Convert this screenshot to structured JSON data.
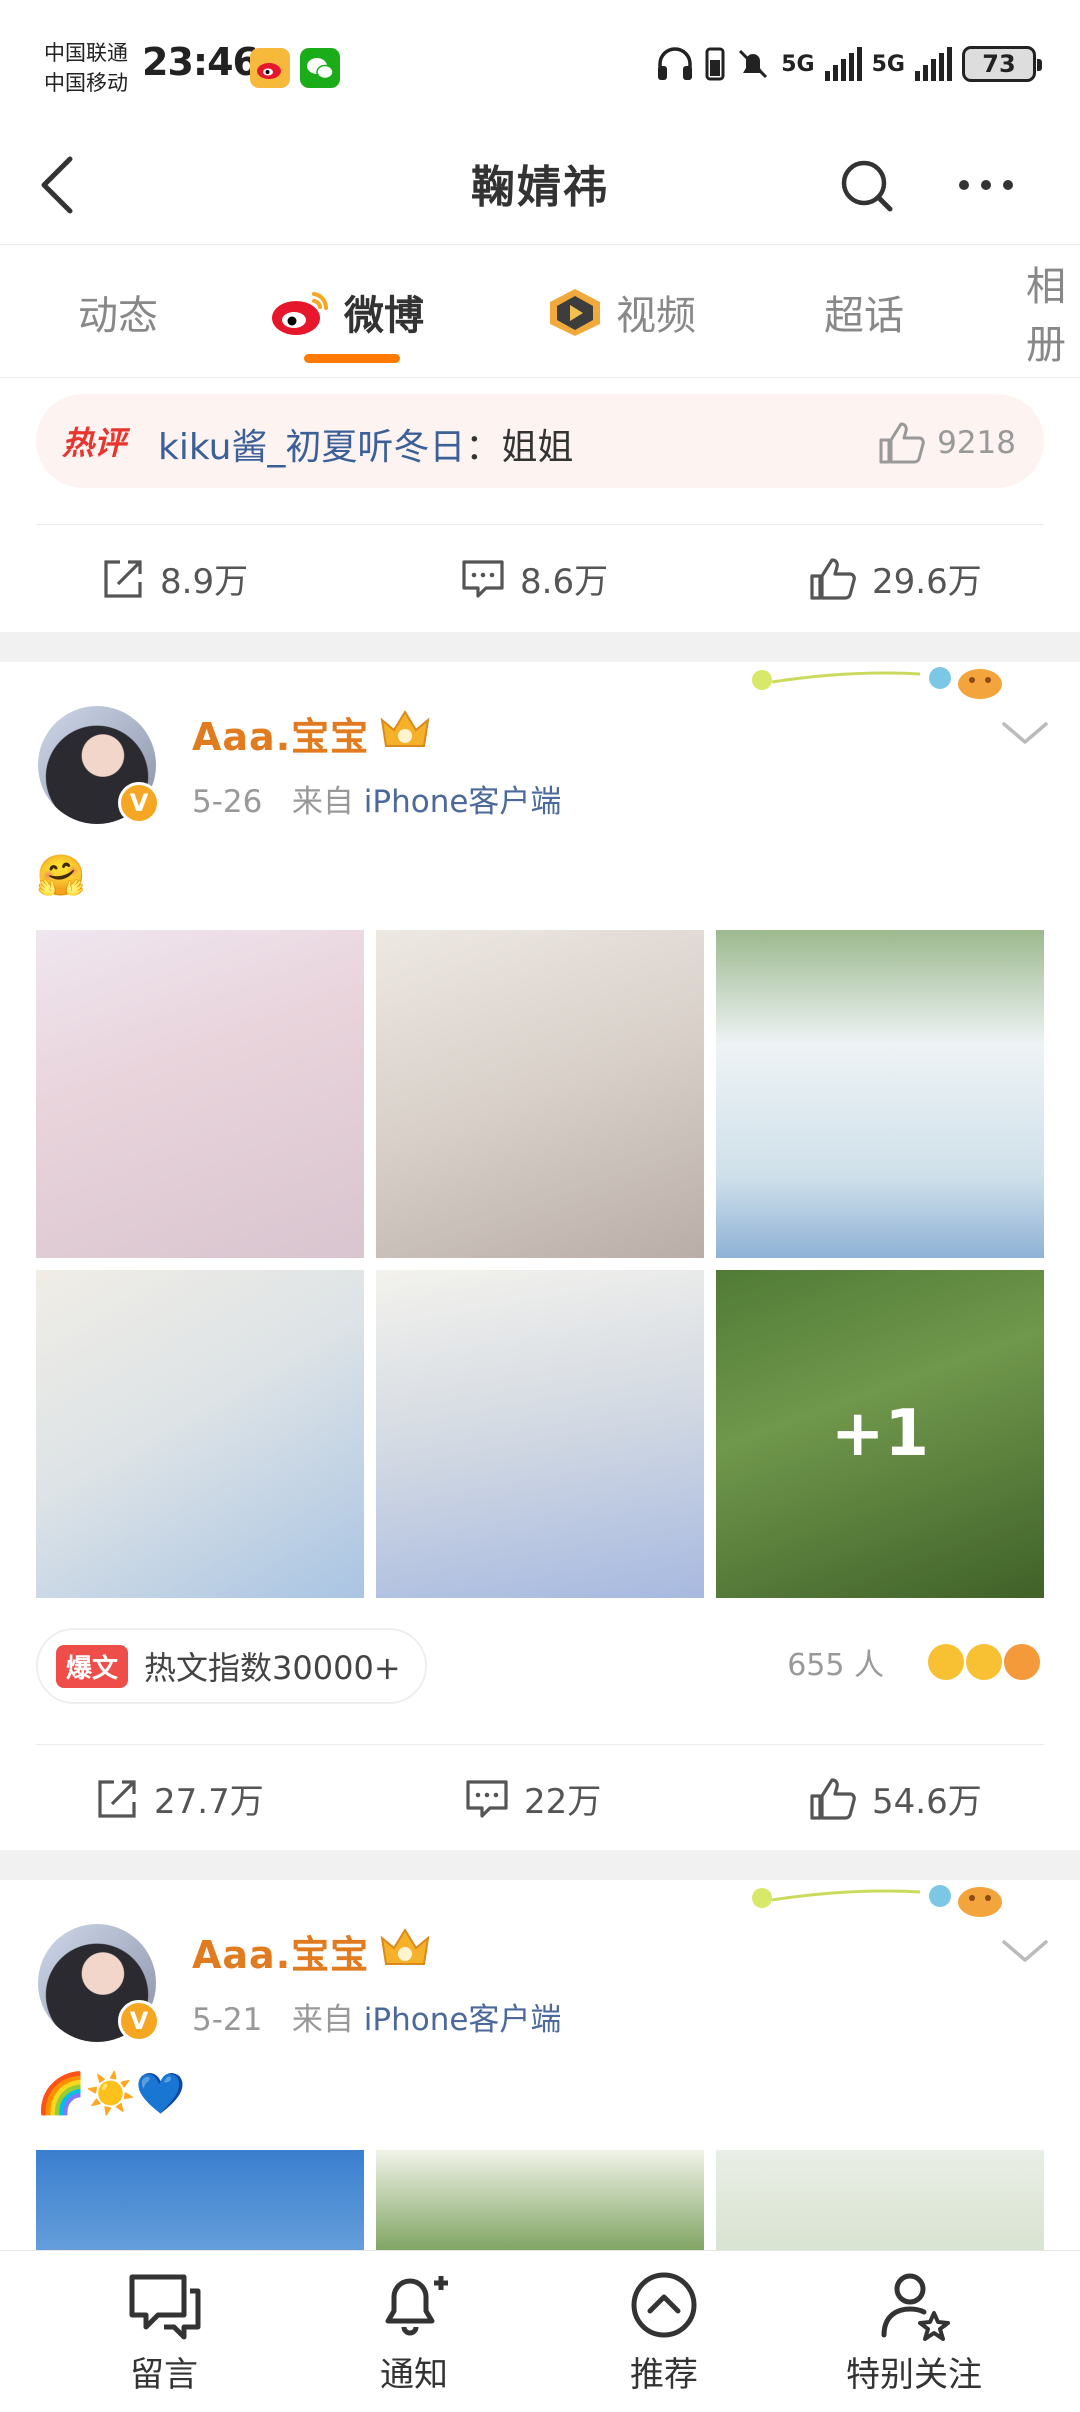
{
  "status_bar": {
    "carrier1": "中国联通",
    "carrier2": "中国移动",
    "time": "23:46",
    "net1": "5G",
    "net2": "5G",
    "battery": "73"
  },
  "header": {
    "title": "鞠婧祎"
  },
  "tabs": [
    {
      "label": "动态"
    },
    {
      "label": "微博"
    },
    {
      "label": "视频"
    },
    {
      "label": "超话"
    },
    {
      "label": "相册"
    }
  ],
  "hot_comment": {
    "badge": "热评",
    "user": "kiku酱_初夏听冬日",
    "text": "：姐姐",
    "likes": "9218"
  },
  "post0_actions": {
    "repost": "8.9万",
    "comment": "8.6万",
    "like": "29.6万"
  },
  "post1": {
    "username": "Aaa.宝宝",
    "date": "5-26",
    "source_prefix": "来自",
    "source": "iPhone客户端",
    "text": "🤗",
    "more_images": "+1",
    "hot_badge": "爆文",
    "hot_index": "热文指数30000+",
    "reactions": "655 人",
    "repost": "27.7万",
    "comment": "22万",
    "like": "54.6万",
    "verified": "V"
  },
  "post2": {
    "username": "Aaa.宝宝",
    "date": "5-21",
    "source_prefix": "来自",
    "source": "iPhone客户端",
    "text": "🌈☀️💙",
    "verified": "V"
  },
  "bottom_nav": [
    {
      "label": "留言",
      "icon": "message-icon"
    },
    {
      "label": "通知",
      "icon": "bell-plus-icon"
    },
    {
      "label": "推荐",
      "icon": "chevron-up-circle-icon"
    },
    {
      "label": "特别关注",
      "icon": "user-star-icon"
    }
  ],
  "colors": {
    "accent": "#ff7a00",
    "username": "#e07b20",
    "link": "#4b6a9b",
    "hot_red": "#e8362f"
  }
}
